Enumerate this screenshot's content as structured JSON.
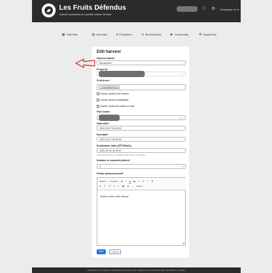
{
  "header": {
    "brand_title": "Les Fruits Défendus",
    "brand_subtitle": "Collectif montréalais de cueillette urbaine de fruits",
    "user_icon": "user-icon",
    "settings_icon": "gear-icon",
    "language_label": "Language: en ▾"
  },
  "nav": {
    "items": [
      {
        "icon": "▦",
        "label": "Calendar"
      },
      {
        "icon": "▤",
        "label": "Harvests"
      },
      {
        "icon": "♦",
        "label": "Properties"
      },
      {
        "icon": "●",
        "label": "Beneficiaries"
      },
      {
        "icon": "☻",
        "label": "Community"
      },
      {
        "icon": "⚒",
        "label": "Equipment"
      }
    ]
  },
  "form": {
    "title": "Edit harvest",
    "harvest_status_label": "Harvest status*",
    "harvest_status_value": "Succeeded",
    "property_label": "Property*",
    "fruit_trees_label": "Fruit trees*",
    "fruit_trees_button": "+ Pear (Bebe Faw)",
    "owner_present_label": "Owner wants to be present",
    "owner_participate_label": "Owner wants to participate",
    "owner_share_label": "Owner wants their share of fruits",
    "pick_leader_label": "Pick leader",
    "start_date_label": "Start date*",
    "start_date_value": "2021-09-07 16:30:00",
    "end_date_label": "End date*",
    "end_date_value": "2021-09-07 18:30:00",
    "publication_label": "Publication Date (OPTIONAL)",
    "publication_value": "2021-09-03 10:42:57",
    "publication_hint": "Leave this field empty to publish harvest as soon as possible",
    "pickers_label": "Number of required pickers*",
    "pickers_value": "3",
    "announcement_label": "Public announcement*",
    "toolbar_row1": [
      "Styles ▾",
      "Format ▾",
      "B",
      "I",
      "U",
      "S",
      "×",
      "x²",
      "❝",
      "⚑"
    ],
    "toolbar_row2": [
      "⧉",
      "✎",
      "☰",
      "≡",
      "A",
      "▦",
      "⊕",
      "⌂",
      "Source"
    ],
    "announcement_body": "Rosiers dans votre famaçi.",
    "save_label": "Save",
    "cancel_label": "Cancel"
  },
  "footer": {
    "text": "Saskatoon is a Free/Libre Software developed by the collective Les Fruits Défendus. Template by Colorlib."
  },
  "colors": {
    "primary": "#1f6fd6",
    "header_bg": "#2b2b2b",
    "arrow": "#d22a2a"
  }
}
